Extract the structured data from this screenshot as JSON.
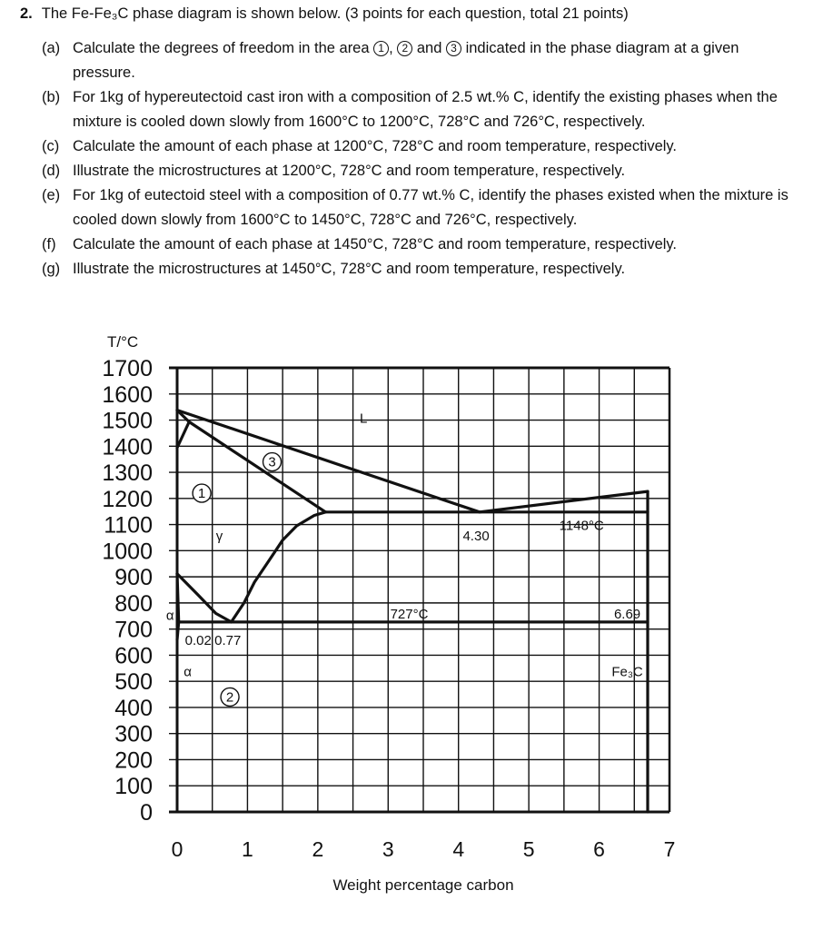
{
  "question": {
    "number": "2.",
    "intro": "The Fe-Fe₃C phase diagram is shown below. (3 points for each question, total 21 points)",
    "parts": [
      {
        "label": "(a)",
        "pre": "Calculate the degrees of freedom in the area ",
        "circles": [
          "1",
          "2",
          "3"
        ],
        "post": " indicated in the phase diagram at a given pressure."
      },
      {
        "label": "(b)",
        "text": "For 1kg of hypereutectoid cast iron with a composition of 2.5 wt.% C, identify the existing phases when the mixture is cooled down slowly from 1600°C to 1200°C, 728°C and 726°C, respectively."
      },
      {
        "label": "(c)",
        "text": "Calculate the amount of each phase at 1200°C, 728°C and room temperature, respectively."
      },
      {
        "label": "(d)",
        "text": "Illustrate the microstructures at 1200°C, 728°C and room temperature, respectively."
      },
      {
        "label": "(e)",
        "text": "For 1kg of eutectoid steel with a composition of 0.77 wt.% C, identify the phases existed when the mixture is cooled down slowly from 1600°C to 1450°C, 728°C and 726°C, respectively."
      },
      {
        "label": "(f)",
        "text": "Calculate the amount of each phase at 1450°C, 728°C and room temperature, respectively."
      },
      {
        "label": "(g)",
        "text": "Illustrate the microstructures at 1450°C, 728°C and room temperature, respectively."
      }
    ]
  },
  "chart_data": {
    "type": "line",
    "title": "Fe-Fe3C phase diagram",
    "xlabel": "Weight percentage carbon",
    "ylabel": "T/°C",
    "xlim": [
      0,
      7
    ],
    "ylim": [
      0,
      1700
    ],
    "xticks": [
      0,
      1,
      2,
      3,
      4,
      5,
      6,
      7
    ],
    "yticks": [
      1700,
      1600,
      1500,
      1400,
      1300,
      1200,
      1100,
      1000,
      900,
      800,
      700,
      600,
      500,
      400,
      300,
      200,
      100,
      0
    ],
    "grid": {
      "x_step": 0.5,
      "y_step": 100,
      "on": true
    },
    "series": [
      {
        "name": "liquidus-left",
        "points": [
          [
            0,
            1538
          ],
          [
            4.3,
            1148
          ]
        ]
      },
      {
        "name": "liquidus-right",
        "points": [
          [
            4.3,
            1148
          ],
          [
            6.69,
            1227
          ]
        ]
      },
      {
        "name": "delta-boundary",
        "points": [
          [
            0,
            1394
          ],
          [
            0.17,
            1493
          ],
          [
            0,
            1538
          ]
        ]
      },
      {
        "name": "solidus",
        "points": [
          [
            0.17,
            1493
          ],
          [
            2.11,
            1148
          ]
        ]
      },
      {
        "name": "eutectic-line",
        "points": [
          [
            2.11,
            1148
          ],
          [
            6.69,
            1148
          ]
        ]
      },
      {
        "name": "Acm-line",
        "points": [
          [
            0.77,
            727
          ],
          [
            0.95,
            800
          ],
          [
            1.1,
            880
          ],
          [
            1.3,
            960
          ],
          [
            1.5,
            1040
          ],
          [
            1.7,
            1095
          ],
          [
            1.95,
            1135
          ],
          [
            2.11,
            1148
          ]
        ]
      },
      {
        "name": "A3-line",
        "points": [
          [
            0,
            912
          ],
          [
            0.3,
            830
          ],
          [
            0.55,
            760
          ],
          [
            0.77,
            727
          ]
        ]
      },
      {
        "name": "alpha-solvus-upper",
        "points": [
          [
            0,
            912
          ],
          [
            0.022,
            727
          ]
        ]
      },
      {
        "name": "eutectoid-line",
        "points": [
          [
            0.022,
            727
          ],
          [
            6.69,
            727
          ]
        ]
      },
      {
        "name": "alpha-solvus-lower",
        "points": [
          [
            0.022,
            727
          ],
          [
            0,
            660
          ]
        ]
      },
      {
        "name": "Fe3C-line",
        "points": [
          [
            6.69,
            1227
          ],
          [
            6.69,
            0
          ]
        ]
      }
    ],
    "annotations": [
      {
        "text": "L",
        "x": 2.65,
        "y": 1490
      },
      {
        "text": "1",
        "kind": "circle",
        "x": 0.35,
        "y": 1220
      },
      {
        "text": "3",
        "kind": "circle",
        "x": 1.35,
        "y": 1340
      },
      {
        "text": "γ",
        "x": 0.6,
        "y": 1040
      },
      {
        "text": "4.30",
        "x": 4.25,
        "y": 1040
      },
      {
        "text": "1148°C",
        "x": 5.75,
        "y": 1080
      },
      {
        "text": "α",
        "x": -0.1,
        "y": 735
      },
      {
        "text": "0.02",
        "x": 0.3,
        "y": 640
      },
      {
        "text": "0.77",
        "x": 0.72,
        "y": 640
      },
      {
        "text": "727°C",
        "x": 3.3,
        "y": 740
      },
      {
        "text": "6.69",
        "x": 6.4,
        "y": 740
      },
      {
        "text": "α",
        "x": 0.15,
        "y": 520
      },
      {
        "text": "2",
        "kind": "circle",
        "x": 0.75,
        "y": 440
      },
      {
        "text": "Fe₃C",
        "x": 6.4,
        "y": 520
      }
    ]
  }
}
